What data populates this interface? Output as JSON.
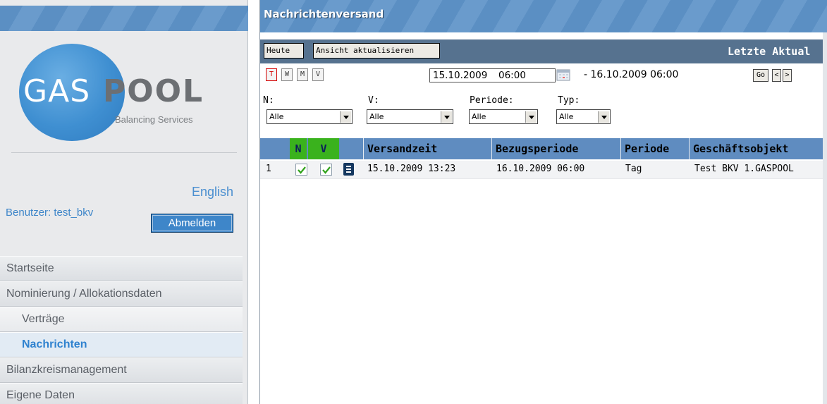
{
  "sidebar": {
    "logo": {
      "gas": "GAS",
      "pool": "POOL",
      "subtitle": "Balancing Services"
    },
    "language_link": "English",
    "user_label": "Benutzer: test_bkv",
    "logout_label": "Abmelden",
    "nav": [
      {
        "label": "Startseite"
      },
      {
        "label": "Nominierung / Allokationsdaten"
      },
      {
        "label": "Verträge"
      },
      {
        "label": "Nachrichten"
      },
      {
        "label": "Bilanzkreismanagement"
      },
      {
        "label": "Eigene Daten"
      }
    ]
  },
  "main": {
    "title": "Nachrichtenversand",
    "toolbar": {
      "today_label": "Heute",
      "refresh_label": "Ansicht aktualisieren",
      "last_update": "Letzte Aktual"
    },
    "period_buttons": [
      "T",
      "W",
      "M",
      "V"
    ],
    "date_from": "15.10.2009",
    "time_from": "06:00",
    "date_to_text": "- 16.10.2009 06:00",
    "go_label": "Go",
    "prev_label": "<",
    "next_label": ">",
    "filters": [
      {
        "label": "N:",
        "value": "Alle"
      },
      {
        "label": "V:",
        "value": "Alle"
      },
      {
        "label": "Periode:",
        "value": "Alle"
      },
      {
        "label": "Typ:",
        "value": "Alle"
      }
    ],
    "table": {
      "headers": {
        "n": "N",
        "v": "V",
        "versandzeit": "Versandzeit",
        "bezugsperiode": "Bezugsperiode",
        "periode": "Periode",
        "geschaeftsobjekt": "Geschäftsobjekt"
      },
      "rows": [
        {
          "nr": "1",
          "n_checked": true,
          "v_checked": true,
          "versandzeit": "15.10.2009 13:23",
          "bezugsperiode": "16.10.2009 06:00",
          "periode": "Tag",
          "geschaeftsobjekt": "Test BKV 1.GASPOOL"
        }
      ]
    }
  },
  "colors": {
    "header_blue": "#5b8fc3",
    "toolbar": "#56728f",
    "nv_green": "#3ab21d",
    "link_blue": "#3e86c9"
  }
}
